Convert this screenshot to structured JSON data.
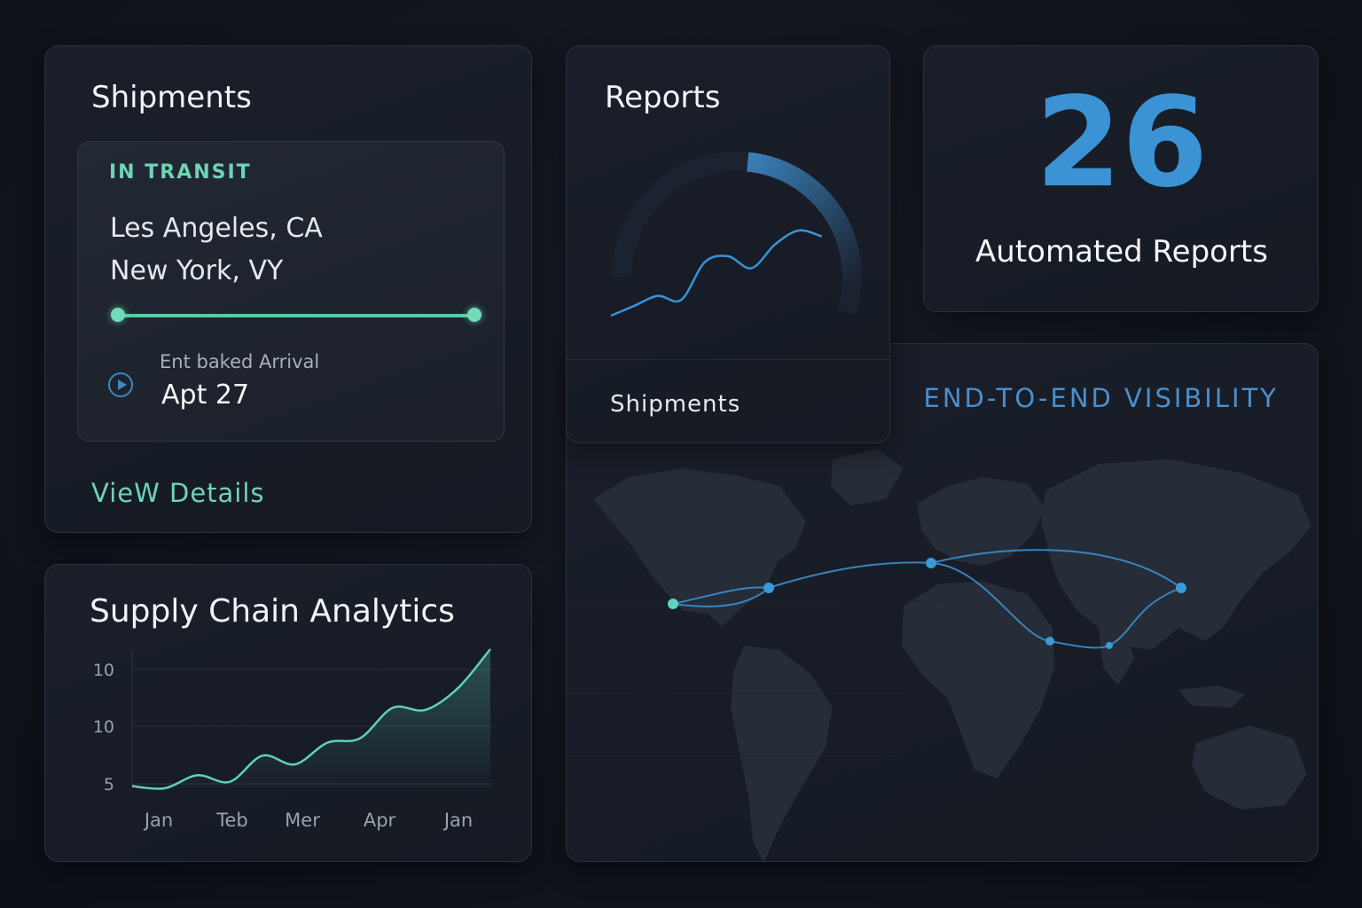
{
  "shipments": {
    "title": "Shipments",
    "status": "IN TRANSIT",
    "origin": "Les Angeles, CA",
    "destination": "New York,  VY",
    "eta_label": "Ent baked Arrival",
    "eta_value": "Apt 27",
    "link_label": "VieW Details"
  },
  "analytics": {
    "title": "Supply Chain Analytics"
  },
  "reports": {
    "title": "Reports",
    "footer": "Shipments"
  },
  "stat": {
    "value": "26",
    "label": "Automated Reports"
  },
  "map": {
    "heading": "END-TO-END VISIBILITY"
  },
  "colors": {
    "accent_teal": "#6fd4b4",
    "accent_blue": "#3b93d6",
    "card_bg": "#181d27",
    "page_bg": "#0f131b"
  },
  "chart_data": [
    {
      "type": "area",
      "title": "Supply Chain Analytics",
      "categories": [
        "Jan",
        "Teb",
        "Mer",
        "Apr",
        "Jan"
      ],
      "y_tick_labels": [
        "10",
        "10",
        "5"
      ],
      "series": [
        {
          "values": [
            5.1,
            5.0,
            5.6,
            5.3,
            6.5,
            6.1,
            7.1,
            7.3,
            8.7,
            8.6,
            9.6,
            11.4
          ]
        }
      ],
      "grid": true
    },
    {
      "type": "line",
      "series": [
        {
          "values": [
            1.0,
            1.5,
            2.0,
            1.8,
            3.7,
            4.0,
            3.4,
            4.6,
            5.3,
            5.0
          ]
        }
      ],
      "ring_progress": 0.42,
      "grid": false
    }
  ]
}
